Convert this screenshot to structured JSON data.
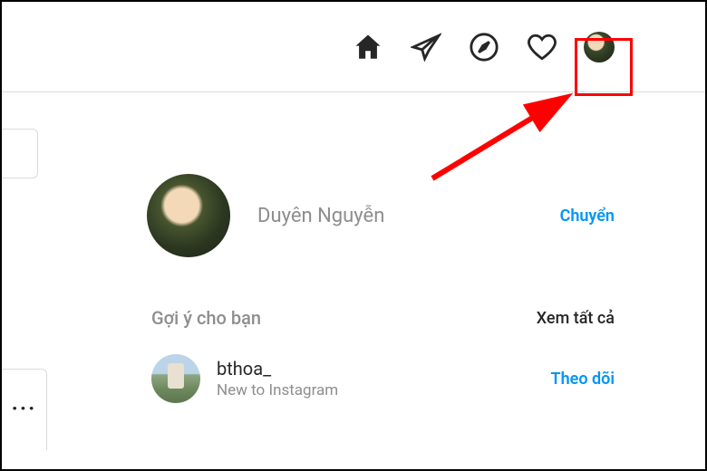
{
  "annotation": {
    "highlight_target": "profile-avatar"
  },
  "current_user": {
    "display_name": "Duyên Nguyễn",
    "switch_label": "Chuyển"
  },
  "suggestions": {
    "heading": "Gợi ý cho bạn",
    "see_all_label": "Xem tất cả",
    "items": [
      {
        "username": "bthoa_",
        "subtitle": "New to Instagram",
        "follow_label": "Theo dõi"
      }
    ]
  },
  "more_menu_glyph": "···"
}
